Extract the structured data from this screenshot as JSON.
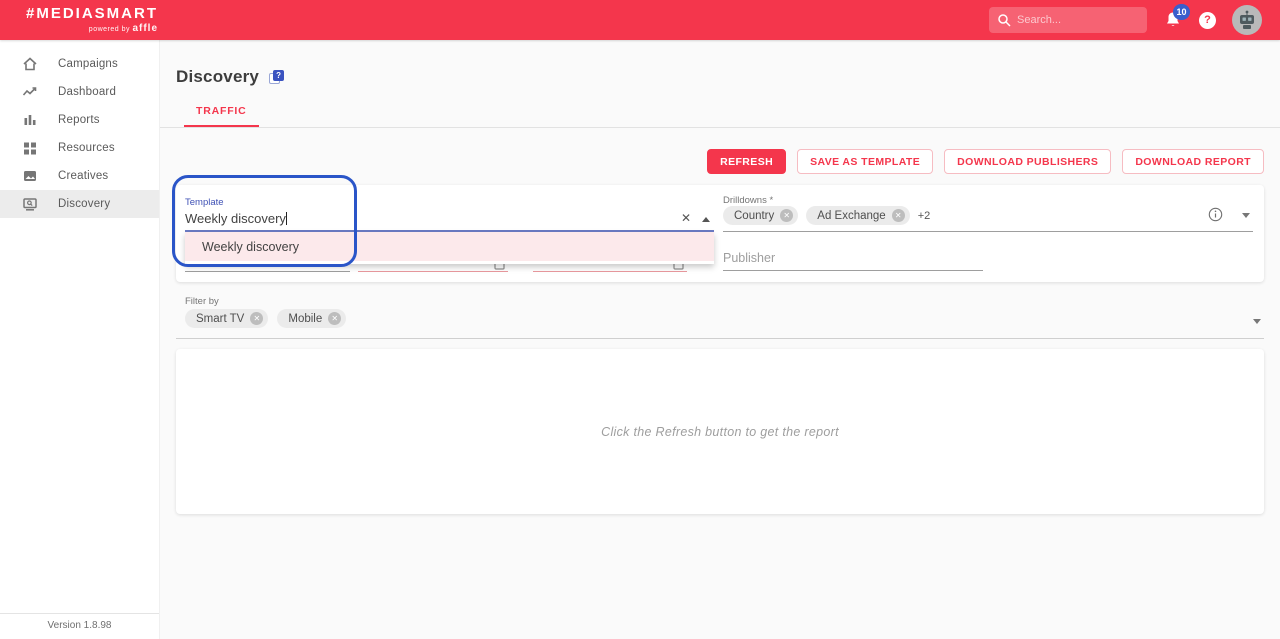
{
  "colors": {
    "brand_red": "#f4364c",
    "badge_blue": "#3a5ecc",
    "annotation_blue": "#2a55c8",
    "focus_indigo": "#3f51b5",
    "highlight_pink": "#fce9eb"
  },
  "header": {
    "logo_title": "#MEDIASMART",
    "logo_powered_by": "powered by",
    "logo_brand": "affle",
    "search_placeholder": "Search...",
    "notification_count": "10",
    "help_glyph": "?"
  },
  "sidebar": {
    "items": [
      {
        "label": "Campaigns"
      },
      {
        "label": "Dashboard"
      },
      {
        "label": "Reports"
      },
      {
        "label": "Resources"
      },
      {
        "label": "Creatives"
      },
      {
        "label": "Discovery",
        "active": true
      }
    ],
    "version": "Version 1.8.98"
  },
  "page": {
    "title": "Discovery",
    "tab": "TRAFFIC",
    "actions": [
      {
        "label": "REFRESH",
        "variant": "filled"
      },
      {
        "label": "SAVE AS TEMPLATE",
        "variant": "outlined"
      },
      {
        "label": "DOWNLOAD PUBLISHERS",
        "variant": "outlined"
      },
      {
        "label": "DOWNLOAD REPORT",
        "variant": "outlined"
      }
    ]
  },
  "form": {
    "template": {
      "label": "Template",
      "value": "Weekly discovery"
    },
    "template_dropdown": {
      "options": [
        "Weekly discovery"
      ],
      "highlighted": "Weekly discovery"
    },
    "drilldowns": {
      "label": "Drilldowns *",
      "chips": [
        "Country",
        "Ad Exchange"
      ],
      "overflow": "+2"
    },
    "publisher": {
      "placeholder": "Publisher"
    },
    "filter_by": {
      "label": "Filter by",
      "chips": [
        "Smart TV",
        "Mobile"
      ]
    }
  },
  "report": {
    "empty_message": "Click the Refresh button to get the report"
  }
}
